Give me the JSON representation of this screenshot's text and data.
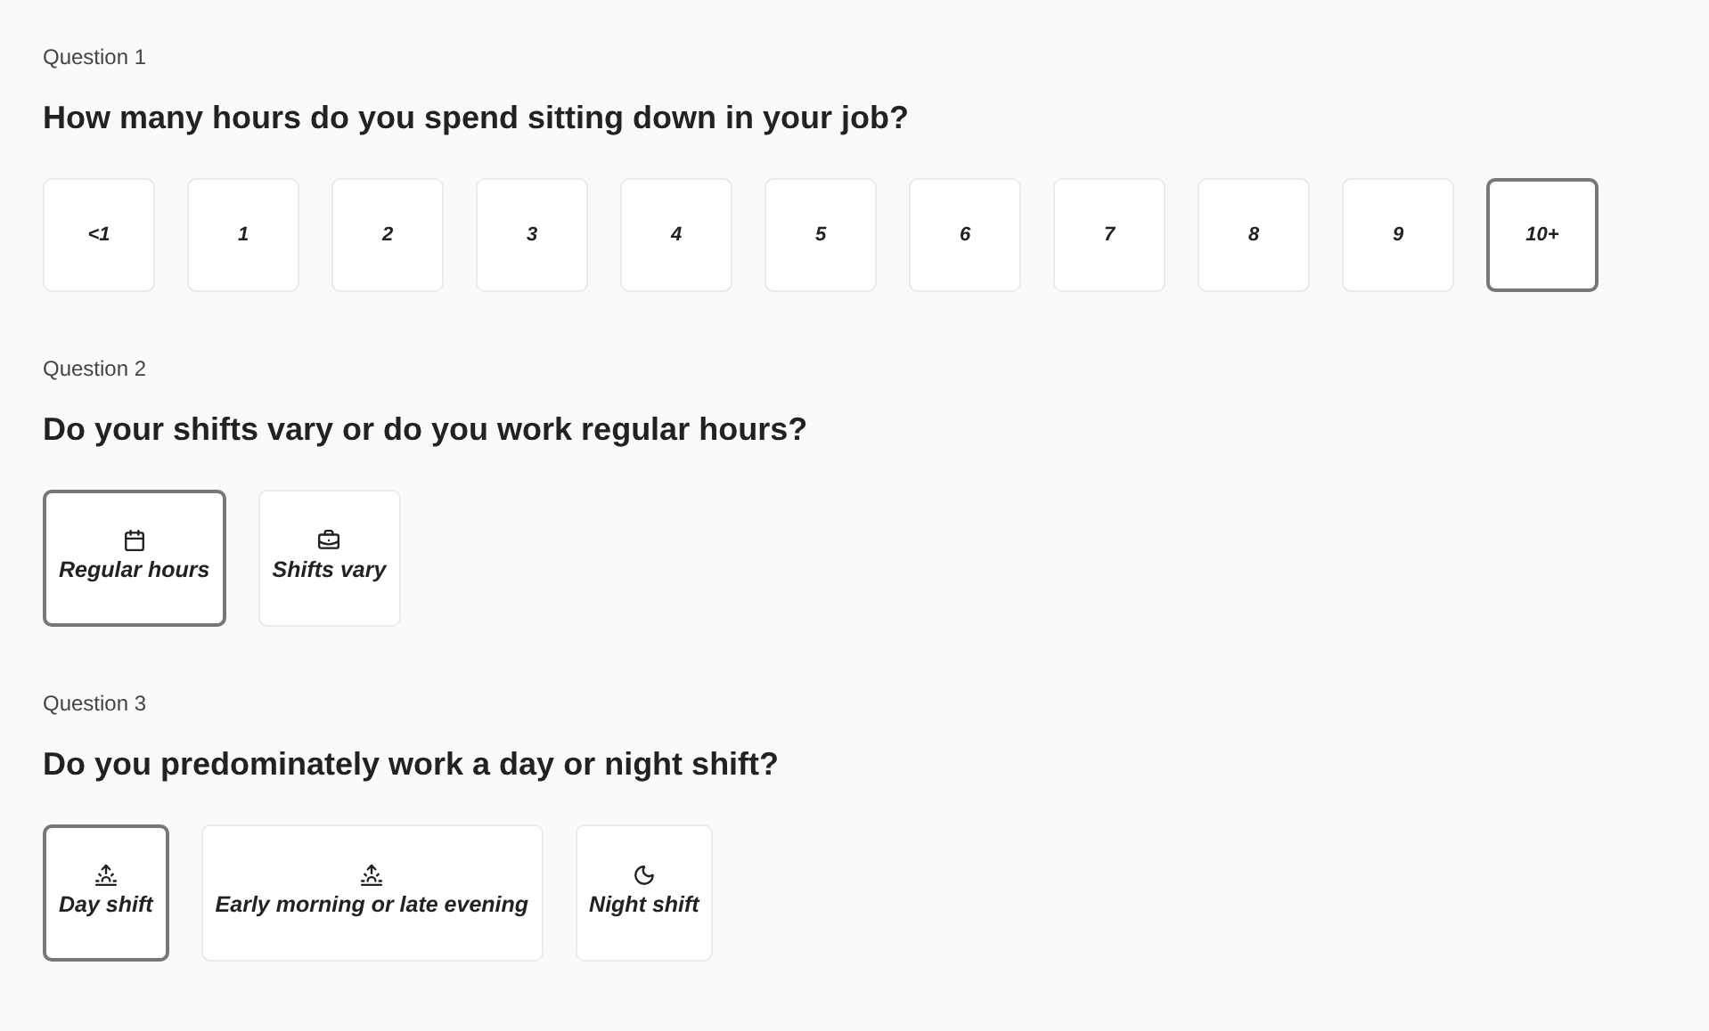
{
  "questions": [
    {
      "label": "Question 1",
      "title": "How many hours do you spend sitting down in your job?",
      "kind": "grid",
      "options": [
        {
          "label": "<1",
          "selected": false
        },
        {
          "label": "1",
          "selected": false
        },
        {
          "label": "2",
          "selected": false
        },
        {
          "label": "3",
          "selected": false
        },
        {
          "label": "4",
          "selected": false
        },
        {
          "label": "5",
          "selected": false
        },
        {
          "label": "6",
          "selected": false
        },
        {
          "label": "7",
          "selected": false
        },
        {
          "label": "8",
          "selected": false
        },
        {
          "label": "9",
          "selected": false
        },
        {
          "label": "10+",
          "selected": true
        }
      ]
    },
    {
      "label": "Question 2",
      "title": "Do your shifts vary or do you work regular hours?",
      "kind": "icons",
      "options": [
        {
          "label": "Regular hours",
          "kind": "calendar",
          "selected": true
        },
        {
          "label": "Shifts vary",
          "kind": "briefcase",
          "selected": false
        }
      ]
    },
    {
      "label": "Question 3",
      "title": "Do you predominately work a day or night shift?",
      "kind": "icons",
      "options": [
        {
          "label": "Day shift",
          "kind": "sunrise",
          "selected": true
        },
        {
          "label": "Early morning or late evening",
          "kind": "sunrise",
          "selected": false
        },
        {
          "label": "Night shift",
          "kind": "moon",
          "selected": false
        }
      ]
    }
  ]
}
